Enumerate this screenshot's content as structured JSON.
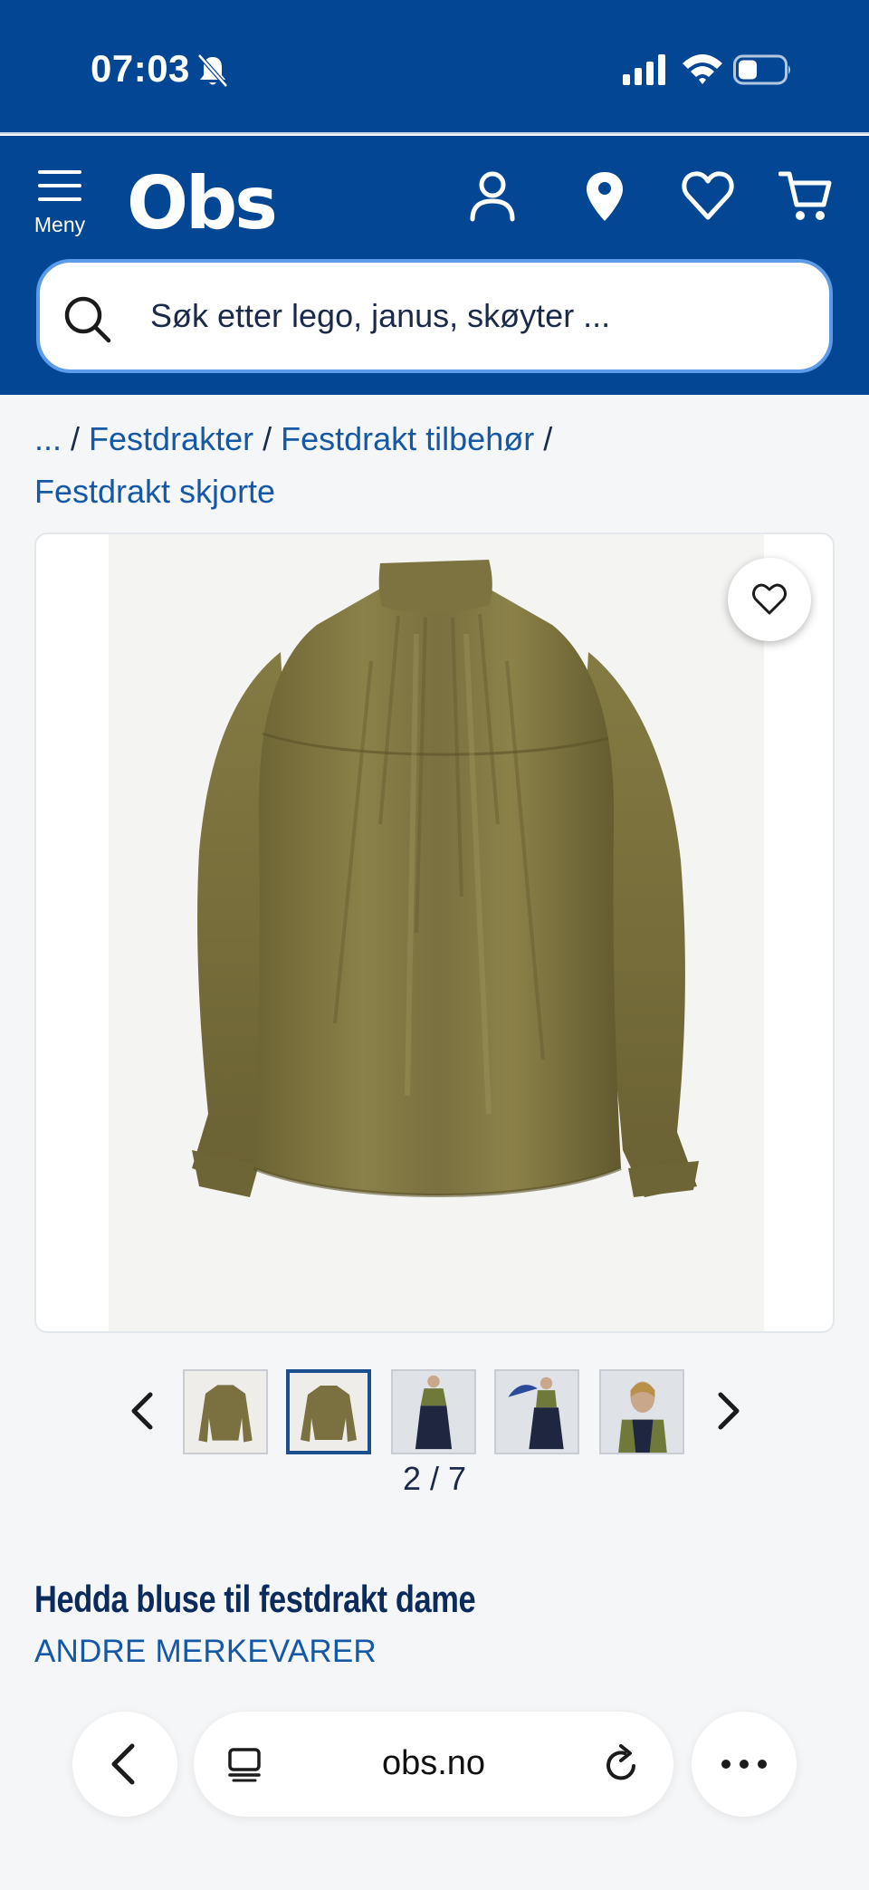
{
  "status_bar": {
    "time": "07:03"
  },
  "header": {
    "menu_label": "Meny",
    "logo": "Obs",
    "icons": [
      "account-icon",
      "location-icon",
      "heart-icon",
      "cart-icon"
    ]
  },
  "search": {
    "placeholder": "Søk etter lego, janus, skøyter ..."
  },
  "breadcrumb": {
    "ellipsis": "...",
    "items": [
      "Festdrakter",
      "Festdrakt tilbehør",
      "Festdrakt skjorte"
    ]
  },
  "gallery": {
    "counter": "2 / 7",
    "visible_thumbnails": 5,
    "active_index": 2
  },
  "product": {
    "title": "Hedda bluse til festdrakt dame",
    "brand": "ANDRE MERKEVARER"
  },
  "browser": {
    "domain": "obs.no"
  },
  "colors": {
    "brand_blue": "#034694",
    "link_blue": "#1458a6",
    "title_navy": "#0b2b5c",
    "blouse_olive": "#7a7040"
  }
}
